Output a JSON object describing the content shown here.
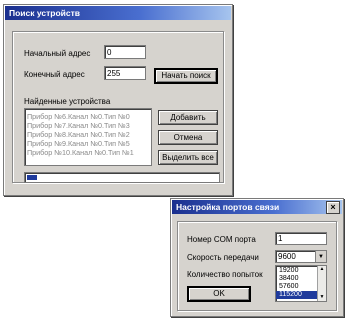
{
  "search_window": {
    "title": "Поиск устройств",
    "start_address_label": "Начальный адрес",
    "start_address_value": "0",
    "end_address_label": "Конечный адрес",
    "end_address_value": "255",
    "start_search_button": "Начать поиск",
    "found_devices_label": "Найденные устройства",
    "devices": [
      "Прибор №6.Канал №0.Тип №0",
      "Прибор №7.Канал №0.Тип №3",
      "Прибор №8.Канал №0.Тип №2",
      "Прибор №9.Канал №0.Тип №5",
      "Прибор №10.Канал №0.Тип №1"
    ],
    "add_button": "Добавить",
    "cancel_button": "Отмена",
    "select_all_button": "Выделить все",
    "progress_fraction": 0.05
  },
  "port_window": {
    "title": "Настройка портов связи",
    "close_glyph": "×",
    "com_port_label": "Номер COM порта",
    "com_port_value": "1",
    "baud_rate_label": "Скорость передачи",
    "baud_rate_value": "9600",
    "retries_label": "Количество попыток",
    "baud_options": [
      "19200",
      "38400",
      "57600",
      "115200"
    ],
    "baud_selected_index": 3,
    "ok_button": "OK",
    "dropdown_arrow": "▼",
    "scroll_up": "▲",
    "scroll_down": "▼"
  },
  "colors": {
    "titlebar_start": "#1a2f8e",
    "window_face": "#d6d3ce",
    "selection": "#1f3a9c"
  }
}
